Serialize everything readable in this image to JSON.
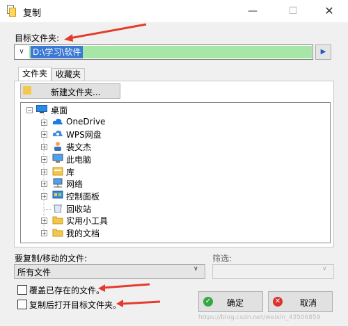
{
  "window": {
    "title": "复制"
  },
  "target": {
    "label": "目标文件夹:",
    "path": "D:\\学习\\软件"
  },
  "tabs": [
    {
      "label": "文件夹"
    },
    {
      "label": "收藏夹"
    }
  ],
  "new_folder_label": "新建文件夹...",
  "tree": [
    {
      "label": "桌面",
      "icon": "desktop-icon"
    },
    {
      "label": "OneDrive",
      "icon": "cloud-icon"
    },
    {
      "label": "WPS网盘",
      "icon": "wps-cloud-icon"
    },
    {
      "label": "裴文杰",
      "icon": "user-icon"
    },
    {
      "label": "此电脑",
      "icon": "computer-icon"
    },
    {
      "label": "库",
      "icon": "library-icon"
    },
    {
      "label": "网络",
      "icon": "network-icon"
    },
    {
      "label": "控制面板",
      "icon": "control-panel-icon"
    },
    {
      "label": "回收站",
      "icon": "recycle-bin-icon"
    },
    {
      "label": "实用小工具",
      "icon": "folder-icon"
    },
    {
      "label": "我的文档",
      "icon": "folder-icon"
    }
  ],
  "files_label": "要复制/移动的文件:",
  "files_value": "所有文件",
  "filter_label": "筛选:",
  "filter_value": "",
  "overwrite_label": "覆盖已存在的文件。",
  "open_after_label": "复制后打开目标文件夹。",
  "ok_label": "确定",
  "cancel_label": "取消",
  "watermark": "https://blog.csdn.net/weixin_43506859"
}
